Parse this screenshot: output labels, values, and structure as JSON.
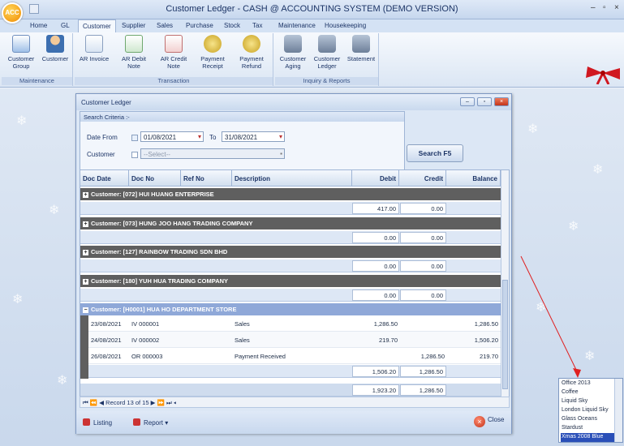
{
  "app": {
    "title": "Customer Ledger - CASH @ ACCOUNTING SYSTEM (DEMO VERSION)",
    "logo_text": "ACC",
    "window_controls": [
      "–",
      "▫",
      "×"
    ]
  },
  "ribbon": {
    "tabs": [
      "Home",
      "GL",
      "Customer",
      "Supplier",
      "Sales",
      "Purchase",
      "Stock",
      "Tax",
      "Maintenance",
      "Housekeeping"
    ],
    "active_tab": "Customer",
    "groups": [
      {
        "label": "Maintenance",
        "buttons": [
          "Customer\nGroup",
          "Customer"
        ]
      },
      {
        "label": "Transaction",
        "buttons": [
          "AR Invoice",
          "AR Debit Note",
          "AR Credit Note",
          "Payment\nReceipt",
          "Payment\nRefund"
        ]
      },
      {
        "label": "Inquiry & Reports",
        "buttons": [
          "Customer\nAging",
          "Customer\nLedger",
          "Statement"
        ]
      }
    ]
  },
  "ledger_window": {
    "title": "Customer Ledger",
    "criteria": {
      "header": "Search Criteria :-",
      "date_from_label": "Date From",
      "date_from": "01/08/2021",
      "to_label": "To",
      "date_to": "31/08/2021",
      "customer_label": "Customer",
      "customer_placeholder": "--Select--"
    },
    "search_button": "Search  F5",
    "columns": [
      "Doc Date",
      "Doc No",
      "Ref No",
      "Description",
      "Debit",
      "Credit",
      "Balance"
    ],
    "groups": [
      {
        "header": "Customer: [072] HUI HUANG ENTERPRISE",
        "debit": "417.00",
        "credit": "0.00"
      },
      {
        "header": "Customer: [073] HUNG JOO HANG TRADING COMPANY",
        "debit": "0.00",
        "credit": "0.00"
      },
      {
        "header": "Customer: [127] RAINBOW TRADING SDN BHD",
        "debit": "0.00",
        "credit": "0.00"
      },
      {
        "header": "Customer: [180] YUH HUA TRADING COMPANY",
        "debit": "0.00",
        "credit": "0.00"
      }
    ],
    "expanded_group": {
      "header": "Customer: [H0001] HUA HO DEPARTMENT STORE",
      "rows": [
        {
          "date": "23/08/2021",
          "doc": "IV 000001",
          "ref": "",
          "desc": "Sales",
          "debit": "1,286.50",
          "credit": "",
          "balance": "1,286.50"
        },
        {
          "date": "24/08/2021",
          "doc": "IV 000002",
          "ref": "",
          "desc": "Sales",
          "debit": "219.70",
          "credit": "",
          "balance": "1,506.20"
        },
        {
          "date": "26/08/2021",
          "doc": "OR 000003",
          "ref": "",
          "desc": "Payment Received",
          "debit": "",
          "credit": "1,286.50",
          "balance": "219.70"
        }
      ],
      "subtotal_debit": "1,506.20",
      "subtotal_credit": "1,286.50"
    },
    "grand_debit": "1,923.20",
    "grand_credit": "1,286.50",
    "navigator": "Record 13 of 15",
    "nav_buttons": [
      "⏮",
      "⏪",
      "◀",
      "▶",
      "⏩",
      "⏭",
      "◂"
    ],
    "bottom_buttons": {
      "listing": "Listing",
      "report": "Report ▾",
      "close": "Close"
    }
  },
  "theme_list": {
    "items": [
      "Office 2013",
      "Coffee",
      "Liquid Sky",
      "London Liquid Sky",
      "Glass Oceans",
      "Stardust",
      "Xmas 2008 Blue"
    ],
    "selected": "Xmas 2008 Blue"
  }
}
